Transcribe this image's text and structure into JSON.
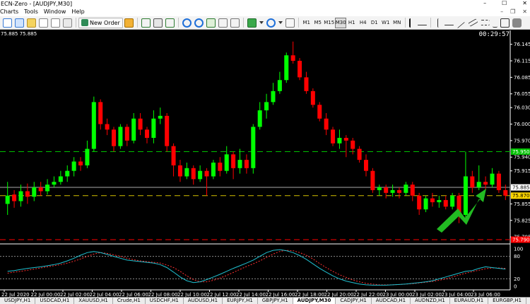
{
  "window": {
    "title": "ECN-Zero - [AUDJPY,M30]",
    "controls": [
      "–",
      "☐",
      "✕"
    ]
  },
  "menu": {
    "items": [
      "Charts",
      "Tools",
      "Window",
      "Help"
    ],
    "mdi_controls": [
      "–",
      "❐",
      "✕"
    ]
  },
  "toolbar": {
    "new_order_label": "New Order",
    "timeframes": [
      "M1",
      "M5",
      "M15",
      "M30",
      "H1",
      "H4",
      "D1",
      "W1",
      "MN"
    ],
    "active_timeframe": "M30"
  },
  "chart": {
    "symbol_label": "AUDJPY,M30",
    "corner_prices": "75.885 75.885",
    "timer": "00:29:57",
    "background": "#000000",
    "bull_color": "#00ff00",
    "bear_color": "#ff0000",
    "price_axis_labels": [
      "76.145",
      "76.115",
      "76.085",
      "76.055",
      "76.030",
      "76.000",
      "75.970",
      "75.940",
      "75.915",
      "75.855",
      "75.825",
      "75.795"
    ],
    "price_tags": [
      {
        "value": "75.950",
        "color": "#00c000",
        "text_color": "#ffffff"
      },
      {
        "value": "75.885",
        "color": "#ffffff",
        "text_color": "#000000"
      },
      {
        "value": "75.870",
        "color": "#ffd700",
        "text_color": "#000000"
      },
      {
        "value": "75.790",
        "color": "#ff0000",
        "text_color": "#ffffff"
      }
    ],
    "indicator_axis_labels": [
      "100",
      "80",
      "20",
      "0"
    ],
    "time_labels": [
      "22 Jul 2020",
      "22 Jul 00:00",
      "22 Jul 02:00",
      "22 Jul 04:00",
      "22 Jul 06:00",
      "22 Jul 08:00",
      "22 Jul 10:00",
      "22 Jul 12:00",
      "22 Jul 14:00",
      "22 Jul 16:00",
      "22 Jul 18:00",
      "22 Jul 20:00",
      "22 Jul 22:00",
      "23 Jul 00:00",
      "23 Jul 02:00",
      "23 Jul 04:00",
      "23 Jul 06:00"
    ],
    "arrow_color": "#22bb22"
  },
  "symbol_tabs": [
    "USDJPY,H1",
    "USDCAD,H1",
    "XAUUSD,H1",
    "Crude,H1",
    "USDCHF,H1",
    "AUDUSD,H1",
    "EURJPY,H1",
    "GBPJPY,H1",
    "AUDJPY,M30",
    "CADJPY,H1",
    "AUDCAD,H1",
    "AUDNZD,H1",
    "EURAUD,H1",
    "EURGBP,H1"
  ],
  "active_tab": "AUDJPY,M30",
  "chart_data": {
    "type": "candlestick",
    "title": "AUDJPY,M30",
    "ylim": [
      75.79,
      76.16
    ],
    "x": [
      "22 Jul 2020",
      "22 Jul 00:00",
      "22 Jul 02:00",
      "22 Jul 04:00",
      "22 Jul 06:00",
      "22 Jul 08:00",
      "22 Jul 10:00",
      "22 Jul 12:00",
      "22 Jul 14:00",
      "22 Jul 16:00",
      "22 Jul 18:00",
      "22 Jul 20:00",
      "22 Jul 22:00",
      "23 Jul 00:00",
      "23 Jul 02:00",
      "23 Jul 04:00",
      "23 Jul 06:00"
    ],
    "candles": [
      [
        75.855,
        75.87,
        75.895,
        75.835
      ],
      [
        75.872,
        75.86,
        75.88,
        75.848
      ],
      [
        75.86,
        75.878,
        75.89,
        75.85
      ],
      [
        75.878,
        75.868,
        75.892,
        75.855
      ],
      [
        75.868,
        75.885,
        75.895,
        75.86
      ],
      [
        75.885,
        75.878,
        75.895,
        75.87
      ],
      [
        75.878,
        75.89,
        75.9,
        75.872
      ],
      [
        75.89,
        75.895,
        75.905,
        75.885
      ],
      [
        75.895,
        75.905,
        75.915,
        75.89
      ],
      [
        75.905,
        75.915,
        75.925,
        75.895
      ],
      [
        75.915,
        75.932,
        75.94,
        75.905
      ],
      [
        75.932,
        75.925,
        75.94,
        75.915
      ],
      [
        75.925,
        75.955,
        75.97,
        75.92
      ],
      [
        75.955,
        76.04,
        76.05,
        75.95
      ],
      [
        76.04,
        76.0,
        76.045,
        75.99
      ],
      [
        76.0,
        75.99,
        76.01,
        75.98
      ],
      [
        75.99,
        75.96,
        75.995,
        75.95
      ],
      [
        75.96,
        75.995,
        76.0,
        75.955
      ],
      [
        75.995,
        75.97,
        76.0,
        75.96
      ],
      [
        75.97,
        76.01,
        76.02,
        75.965
      ],
      [
        76.01,
        75.99,
        76.02,
        75.98
      ],
      [
        75.99,
        75.975,
        75.995,
        75.965
      ],
      [
        75.975,
        76.01,
        76.025,
        75.965
      ],
      [
        76.01,
        76.015,
        76.03,
        76.0
      ],
      [
        76.015,
        75.96,
        76.02,
        75.95
      ],
      [
        75.96,
        75.925,
        75.965,
        75.905
      ],
      [
        75.925,
        75.905,
        75.935,
        75.895
      ],
      [
        75.905,
        75.92,
        75.93,
        75.9
      ],
      [
        75.92,
        75.9,
        75.925,
        75.89
      ],
      [
        75.9,
        75.915,
        75.925,
        75.895
      ],
      [
        75.915,
        75.905,
        75.92,
        75.87
      ],
      [
        75.905,
        75.93,
        75.935,
        75.9
      ],
      [
        75.93,
        75.915,
        75.94,
        75.905
      ],
      [
        75.915,
        75.945,
        75.96,
        75.91
      ],
      [
        75.945,
        75.92,
        75.95,
        75.9
      ],
      [
        75.92,
        75.935,
        75.955,
        75.91
      ],
      [
        75.935,
        75.92,
        75.945,
        75.91
      ],
      [
        75.92,
        75.995,
        76.0,
        75.91
      ],
      [
        75.995,
        76.025,
        76.04,
        75.99
      ],
      [
        76.025,
        76.04,
        76.055,
        76.01
      ],
      [
        76.04,
        76.06,
        76.075,
        76.035
      ],
      [
        76.06,
        76.08,
        76.095,
        76.055
      ],
      [
        76.08,
        76.125,
        76.13,
        76.075
      ],
      [
        76.125,
        76.115,
        76.15,
        76.11
      ],
      [
        76.115,
        76.085,
        76.12,
        76.08
      ],
      [
        76.085,
        76.06,
        76.095,
        76.055
      ],
      [
        76.06,
        76.035,
        76.065,
        76.03
      ],
      [
        76.035,
        76.01,
        76.04,
        76.005
      ],
      [
        76.01,
        75.99,
        76.02,
        75.98
      ],
      [
        75.99,
        75.965,
        75.995,
        75.96
      ],
      [
        75.965,
        75.975,
        75.99,
        75.955
      ],
      [
        75.975,
        75.97,
        75.98,
        75.94
      ],
      [
        75.97,
        75.955,
        75.975,
        75.945
      ],
      [
        75.955,
        75.935,
        75.96,
        75.93
      ],
      [
        75.935,
        75.915,
        75.945,
        75.905
      ],
      [
        75.915,
        75.88,
        75.92,
        75.875
      ],
      [
        75.88,
        75.885,
        75.89,
        75.87
      ],
      [
        75.885,
        75.875,
        75.89,
        75.865
      ],
      [
        75.875,
        75.88,
        75.89,
        75.868
      ],
      [
        75.88,
        75.875,
        75.885,
        75.865
      ],
      [
        75.875,
        75.89,
        75.895,
        75.87
      ],
      [
        75.89,
        75.87,
        75.895,
        75.86
      ],
      [
        75.87,
        75.845,
        75.875,
        75.835
      ],
      [
        75.845,
        75.865,
        75.87,
        75.84
      ],
      [
        75.865,
        75.858,
        75.875,
        75.85
      ],
      [
        75.858,
        75.862,
        75.87,
        75.848
      ],
      [
        75.862,
        75.85,
        75.87,
        75.845
      ],
      [
        75.85,
        75.87,
        75.875,
        75.845
      ],
      [
        75.87,
        75.835,
        75.875,
        75.82
      ],
      [
        75.835,
        75.905,
        75.95,
        75.83
      ],
      [
        75.905,
        75.885,
        75.915,
        75.875
      ],
      [
        75.885,
        75.895,
        75.925,
        75.88
      ],
      [
        75.895,
        75.89,
        75.905,
        75.88
      ],
      [
        75.89,
        75.91,
        75.92,
        75.885
      ],
      [
        75.91,
        75.88,
        75.915,
        75.875
      ],
      [
        75.88,
        75.87,
        75.89,
        75.862
      ]
    ],
    "indicator": {
      "name": "Stochastic",
      "ylim": [
        0,
        100
      ],
      "levels": [
        80,
        20
      ],
      "main": [
        40,
        42,
        45,
        48,
        50,
        52,
        55,
        58,
        62,
        68,
        75,
        83,
        90,
        93,
        90,
        85,
        80,
        75,
        70,
        68,
        66,
        64,
        62,
        58,
        50,
        38,
        25,
        15,
        10,
        12,
        18,
        25,
        32,
        40,
        48,
        55,
        62,
        70,
        80,
        90,
        96,
        98,
        95,
        90,
        82,
        72,
        60,
        48,
        38,
        28,
        20,
        14,
        10,
        6,
        4,
        3,
        3,
        3,
        4,
        5,
        6,
        8,
        10,
        12,
        15,
        20,
        25,
        30,
        35,
        40,
        42,
        48,
        52,
        50,
        48,
        46
      ],
      "signal": [
        35,
        38,
        40,
        43,
        46,
        49,
        52,
        55,
        58,
        62,
        67,
        73,
        80,
        86,
        90,
        88,
        84,
        80,
        75,
        71,
        68,
        66,
        64,
        62,
        57,
        50,
        40,
        28,
        18,
        12,
        12,
        16,
        22,
        29,
        37,
        45,
        53,
        60,
        68,
        77,
        86,
        93,
        96,
        95,
        90,
        83,
        73,
        61,
        50,
        40,
        31,
        24,
        17,
        12,
        8,
        6,
        4,
        4,
        4,
        5,
        6,
        7,
        9,
        11,
        13,
        16,
        20,
        25,
        30,
        35,
        39,
        43,
        47,
        49,
        49,
        48
      ]
    }
  }
}
